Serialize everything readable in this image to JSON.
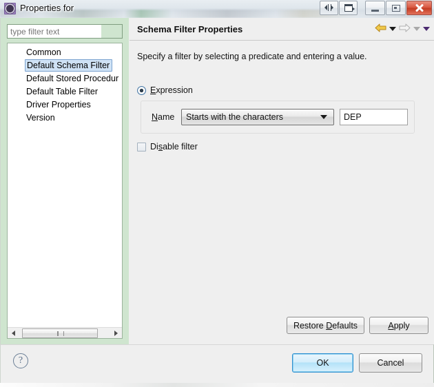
{
  "window": {
    "title": "Properties for",
    "icon": "gear-icon",
    "buttons": {
      "restore_view": "restore-view-icon",
      "detach": "detach-icon",
      "minimize": "minimize-icon",
      "maximize": "maximize-icon",
      "close": "close-icon"
    }
  },
  "sidebar": {
    "filter": {
      "value": "",
      "placeholder": "type filter text"
    },
    "items": [
      {
        "label": "Common",
        "selected": false
      },
      {
        "label": "Default Schema Filter",
        "selected": true
      },
      {
        "label": "Default Stored Procedur",
        "selected": false
      },
      {
        "label": "Default Table Filter",
        "selected": false
      },
      {
        "label": "Driver Properties",
        "selected": false
      },
      {
        "label": "Version",
        "selected": false
      }
    ],
    "scrollbar": {
      "left_arrow": "scroll-left-icon",
      "right_arrow": "scroll-right-icon"
    }
  },
  "panel": {
    "title": "Schema Filter Properties",
    "description": "Specify a filter by selecting a predicate and entering a value.",
    "nav": {
      "back_icon": "arrow-back-icon",
      "back_menu_icon": "chevron-down-icon",
      "forward_icon": "arrow-forward-icon",
      "forward_menu_icon": "chevron-down-icon",
      "view_menu_icon": "chevron-down-icon"
    },
    "expression": {
      "label": "Expression",
      "mnemonic": "E",
      "selected": true
    },
    "name_row": {
      "label": "Name",
      "mnemonic": "N",
      "predicate": "Starts with the characters",
      "predicate_caret": "chevron-down-icon",
      "value": "DEP"
    },
    "disable_filter": {
      "label": "Disable filter",
      "mnemonic": "s",
      "checked": false
    },
    "restore_defaults": "Restore Defaults",
    "apply": "Apply"
  },
  "footer": {
    "help_icon": "help-icon",
    "ok": "OK",
    "cancel": "Cancel"
  },
  "colors": {
    "sidebar_green": "#cfe5cf",
    "panel_gray": "#efefef",
    "selection_blue": "#cfe2f5",
    "default_button_blue": "#b4e2f8",
    "close_red": "#c23b22",
    "arrow_gold": "#e8b838"
  }
}
